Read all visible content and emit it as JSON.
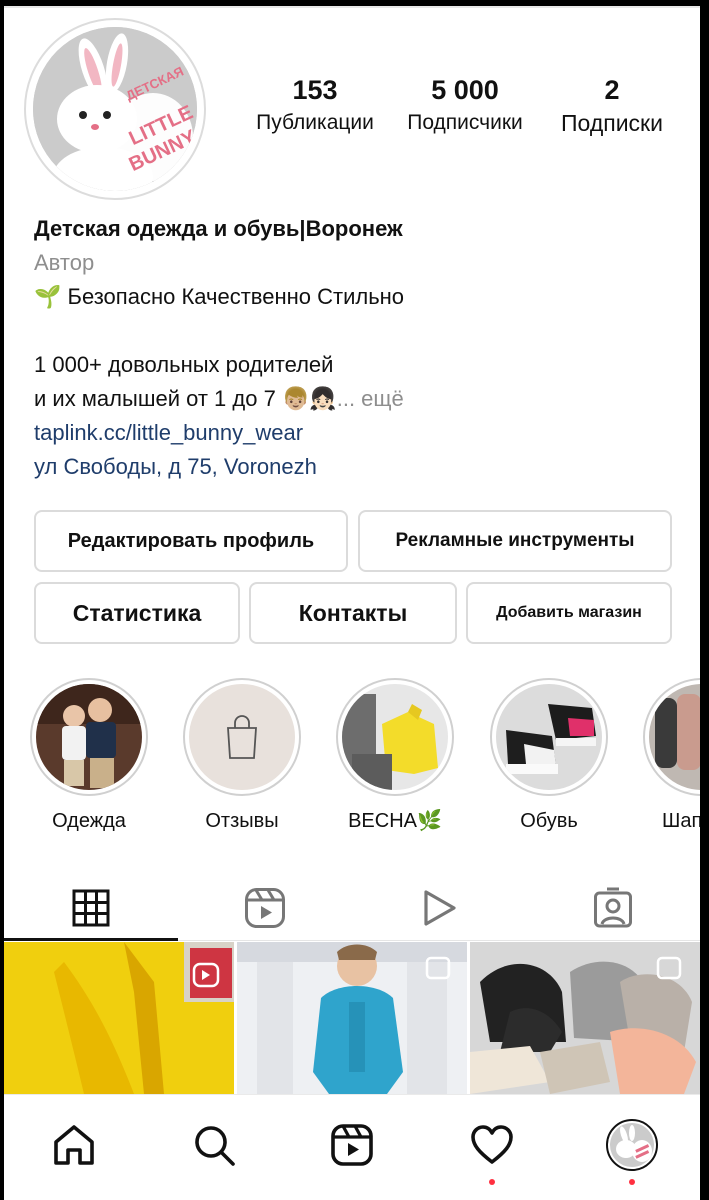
{
  "profile": {
    "avatar_text": [
      "ДЕТСКАЯ ОДЕЖДА",
      "LITTLE",
      "BUNNY"
    ],
    "stats": [
      {
        "value": "153",
        "label": "Публикации"
      },
      {
        "value": "5 000",
        "label": "Подписчики"
      },
      {
        "value": "2",
        "label": "Подписки"
      }
    ],
    "name": "Детская одежда и обувь|Воронеж",
    "category": "Автор",
    "bio_line1_emoji": "🌱",
    "bio_line1": "Безопасно Качественно Стильно",
    "bio_line2": "1 000+ довольных родителей",
    "bio_line3": "и их малышей от 1 до 7",
    "bio_line3_emoji": "👦🏼👧🏻",
    "more": "... ещё",
    "link": "taplink.cc/little_bunny_wear",
    "address": "ул Свободы, д 75, Voronezh"
  },
  "buttons": {
    "edit": "Редактировать профиль",
    "ads": "Рекламные инструменты",
    "stats": "Статистика",
    "contacts": "Контакты",
    "shop": "Добавить магазин"
  },
  "highlights": [
    {
      "label": "Одежда"
    },
    {
      "label": "Отзывы"
    },
    {
      "label": "ВЕСНА🌿"
    },
    {
      "label": "Обувь"
    },
    {
      "label": "Шап"
    }
  ],
  "tabs": [
    "grid-icon",
    "reels-icon",
    "video-icon",
    "tagged-icon"
  ],
  "bottom_nav": [
    "home-icon",
    "search-icon",
    "reels-icon",
    "heart-icon",
    "profile-avatar"
  ],
  "colors": {
    "link": "#1f3d6b",
    "muted": "#8e8e8e",
    "notification": "#ff3040",
    "brand_pink": "#e46f86"
  }
}
